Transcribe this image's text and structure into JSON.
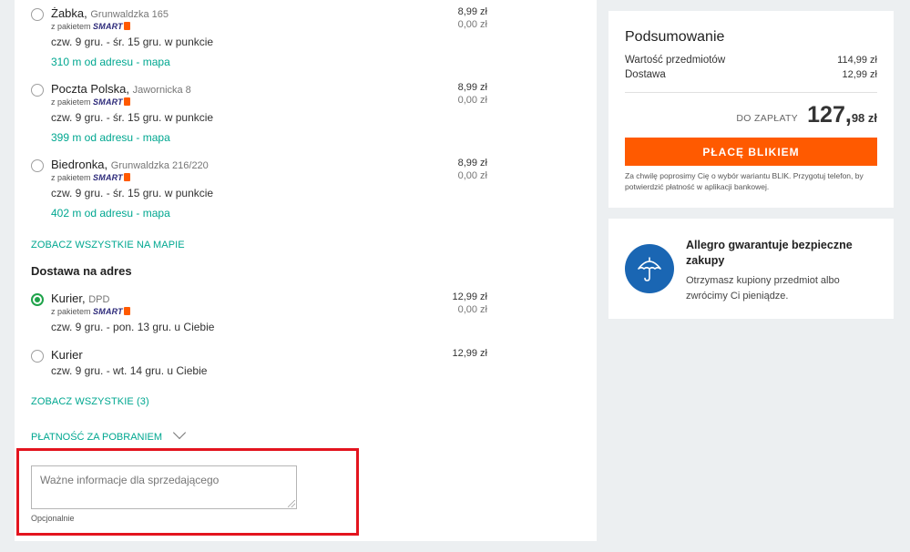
{
  "pickup_points": [
    {
      "name": "Żabka",
      "address": "Grunwaldzka 165",
      "smart_prefix": "z pakietem",
      "smart_brand": "SMART",
      "eta": "czw. 9 gru. - śr. 15 gru. w punkcie",
      "distance": "310 m od adresu - mapa",
      "price": "8,99 zł",
      "smart_price": "0,00 zł"
    },
    {
      "name": "Poczta Polska",
      "address": "Jawornicka 8",
      "smart_prefix": "z pakietem",
      "smart_brand": "SMART",
      "eta": "czw. 9 gru. - śr. 15 gru. w punkcie",
      "distance": "399 m od adresu - mapa",
      "price": "8,99 zł",
      "smart_price": "0,00 zł"
    },
    {
      "name": "Biedronka",
      "address": "Grunwaldzka 216/220",
      "smart_prefix": "z pakietem",
      "smart_brand": "SMART",
      "eta": "czw. 9 gru. - śr. 15 gru. w punkcie",
      "distance": "402 m od adresu - mapa",
      "price": "8,99 zł",
      "smart_price": "0,00 zł"
    }
  ],
  "see_all_on_map": "ZOBACZ WSZYSTKIE NA MAPIE",
  "address_delivery": {
    "title": "Dostawa na adres",
    "options": [
      {
        "name": "Kurier",
        "carrier": "DPD",
        "selected": true,
        "smart_prefix": "z pakietem",
        "smart_brand": "SMART",
        "eta": "czw. 9 gru. - pon. 13 gru. u Ciebie",
        "price": "12,99 zł",
        "smart_price": "0,00 zł"
      },
      {
        "name": "Kurier",
        "carrier": "",
        "selected": false,
        "eta": "czw. 9 gru. - wt. 14 gru. u Ciebie",
        "price": "12,99 zł"
      }
    ],
    "see_all": "ZOBACZ WSZYSTKIE (3)"
  },
  "cash_on_delivery": "PŁATNOŚĆ ZA POBRANIEM",
  "seller_note": {
    "placeholder": "Ważne informacje dla sprzedającego",
    "hint": "Opcjonalnie"
  },
  "summary": {
    "title": "Podsumowanie",
    "items_label": "Wartość przedmiotów",
    "items_value": "114,99 zł",
    "shipping_label": "Dostawa",
    "shipping_value": "12,99 zł",
    "total_label": "DO ZAPŁATY",
    "total_int": "127,",
    "total_dec": "98 zł",
    "pay_button": "PŁACĘ BLIKIEM",
    "blik_note": "Za chwilę poprosimy Cię o wybór wariantu BLIK. Przygotuj telefon, by potwierdzić płatność w aplikacji bankowej."
  },
  "guarantee": {
    "title": "Allegro gwarantuje bezpieczne zakupy",
    "text": "Otrzymasz kupiony przedmiot albo zwrócimy Ci pieniądze.",
    "icon": "umbrella-icon"
  },
  "colors": {
    "accent_orange": "#ff5a00",
    "link_teal": "#00a790",
    "selected_green": "#1fa34a",
    "guarantee_blue": "#1a66b3",
    "highlight_red": "#e3141e"
  }
}
